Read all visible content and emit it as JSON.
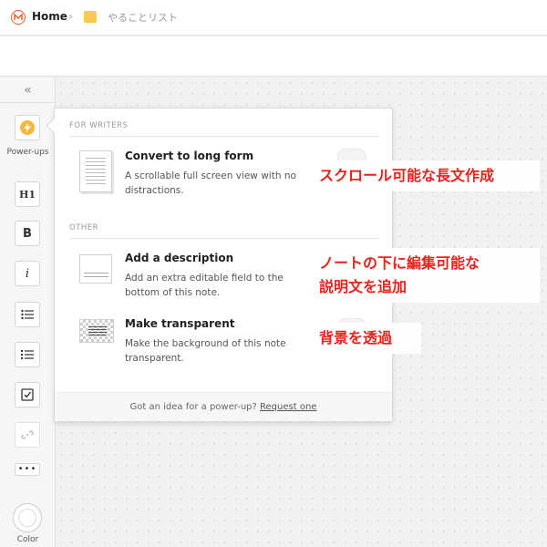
{
  "header": {
    "home_label": "Home",
    "separator": "›",
    "current_board": "やることリスト",
    "folder_color": "#f8c954",
    "logo_color": "#e1592b"
  },
  "sidebar": {
    "collapse_glyph": "«",
    "tools": [
      {
        "name": "power-ups",
        "label": "Power-ups",
        "icon": "lightning-icon"
      },
      {
        "name": "heading",
        "glyph": "H1"
      },
      {
        "name": "bold",
        "glyph": "B"
      },
      {
        "name": "italic",
        "glyph": "i"
      },
      {
        "name": "bullet-list",
        "icon": "bullet-list-icon"
      },
      {
        "name": "numbered-list",
        "icon": "numbered-list-icon"
      },
      {
        "name": "checkbox",
        "icon": "checkbox-icon"
      },
      {
        "name": "link",
        "icon": "link-icon"
      },
      {
        "name": "more",
        "glyph": "•••"
      },
      {
        "name": "color",
        "label": "Color"
      }
    ]
  },
  "popup": {
    "section_writers": "FOR WRITERS",
    "section_other": "OTHER",
    "items": [
      {
        "title": "Convert to long form",
        "description": "A scrollable full screen view with no distractions."
      },
      {
        "title": "Add a description",
        "description": "Add an extra editable field to the bottom of this note."
      },
      {
        "title": "Make transparent",
        "description": "Make the background of this note transparent."
      }
    ],
    "footer_text": "Got an idea for a power-up?",
    "footer_link": "Request one"
  },
  "annotations": {
    "long_form": "スクロール可能な長文作成",
    "description_line1": "ノートの下に編集可能な",
    "description_line2": "説明文を追加",
    "transparent": "背景を透過",
    "color": "#e8231b"
  }
}
